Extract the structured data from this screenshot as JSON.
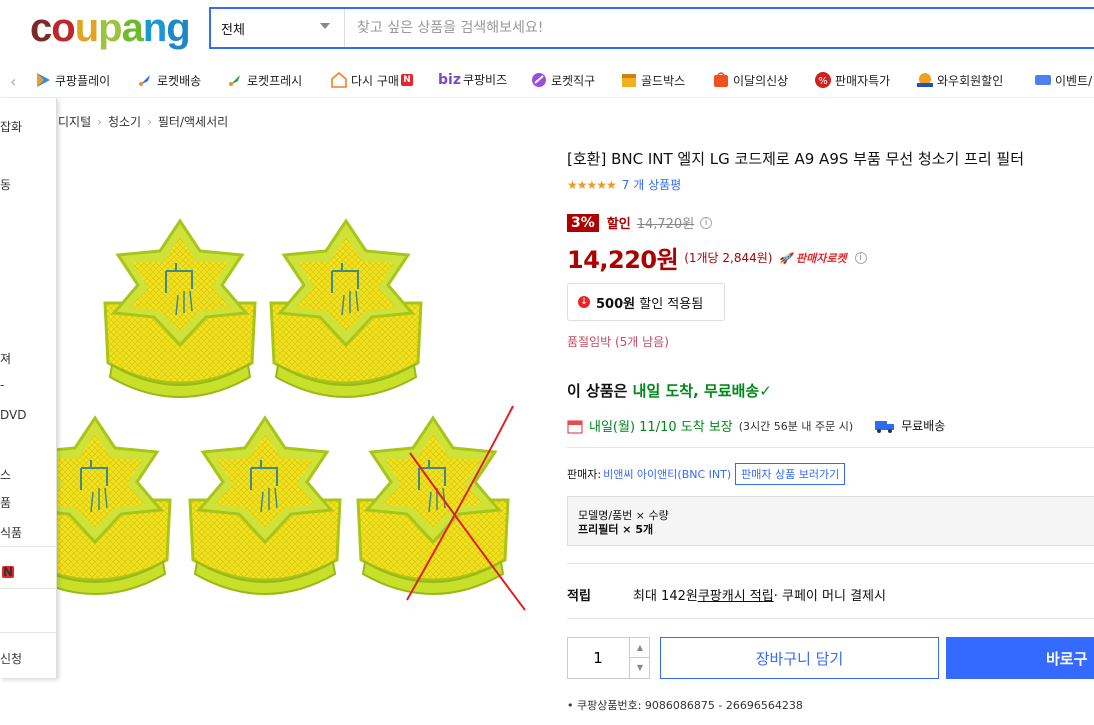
{
  "header": {
    "logo_letters": [
      "c",
      "o",
      "u",
      "p",
      "a",
      "n",
      "g"
    ],
    "logo_colors": [
      "#7d2926",
      "#c0272d",
      "#e3a51f",
      "#9bc53d",
      "#6fba2c",
      "#1b97d4",
      "#1e88c7"
    ],
    "search_category": "전체",
    "search_placeholder": "찾고 싶은 상품을 검색해보세요!"
  },
  "nav": {
    "items": [
      {
        "label": "쿠팡플레이",
        "icon": "play-icon"
      },
      {
        "label": "로켓배송",
        "icon": "rocket-icon"
      },
      {
        "label": "로켓프레시",
        "icon": "rocket-fresh-icon"
      },
      {
        "label": "다시 구매",
        "icon": "rebuy-icon",
        "badge": "N"
      },
      {
        "label": "쿠팡비즈",
        "prefix": "biz",
        "icon": "biz-icon"
      },
      {
        "label": "로켓직구",
        "icon": "global-icon"
      },
      {
        "label": "골드박스",
        "icon": "goldbox-icon"
      },
      {
        "label": "이달의신상",
        "icon": "new-icon"
      },
      {
        "label": "판매자특가",
        "icon": "seller-sale-icon"
      },
      {
        "label": "와우회원할인",
        "icon": "wow-icon"
      },
      {
        "label": "이벤트/",
        "icon": "event-icon"
      }
    ]
  },
  "side_menu": {
    "items": [
      "잡화",
      "동",
      "져",
      "-",
      "DVD",
      "스",
      "품",
      "식품",
      "N",
      "신청"
    ]
  },
  "breadcrumb": [
    "디지털",
    "청소기",
    "필터/액세서리"
  ],
  "product": {
    "title": "[호환] BNC INT 엘지 LG 코드제로 A9 A9S 부품 무선 청소기 프리 필터",
    "stars": "★★★★★",
    "rating": 5,
    "review_count": "7 개 상품평",
    "discount_rate": "3%",
    "discount_label": "할인",
    "original_price": "14,720원",
    "price": "14,220원",
    "unit_price": "(1개당 2,844원)",
    "seller_badge": "판매자로켓",
    "coupon_amount": "500원",
    "coupon_text": "할인 적용됨",
    "stock_warning": "품절임박 (5개 남음)",
    "delivery_prefix": "이 상품은 ",
    "delivery_highlight": "내일 도착, 무료배송✓",
    "arrival_date": "내일(월) 11/10 도착 보장",
    "arrival_note": "(3시간 56분 내 주문 시)",
    "shipping": "무료배송",
    "vendor_label": "판매자:",
    "vendor_name": "비앤씨 아이앤티(BNC INT)",
    "vendor_button": "판매자 상품 보러가기",
    "option_header": "모델명/품번 × 수량",
    "option_value": "프리필터 × 5개",
    "reward_label": "적립",
    "reward_max": "최대 142원 ",
    "reward_link": "쿠팡캐시 적립",
    "reward_tail": " · 쿠페이 머니 결제시",
    "quantity": "1",
    "cart_button": "장바구니 담기",
    "buy_button": "바로구",
    "product_id": "쿠팡상품번호: 9086086875 - 26696564238"
  }
}
